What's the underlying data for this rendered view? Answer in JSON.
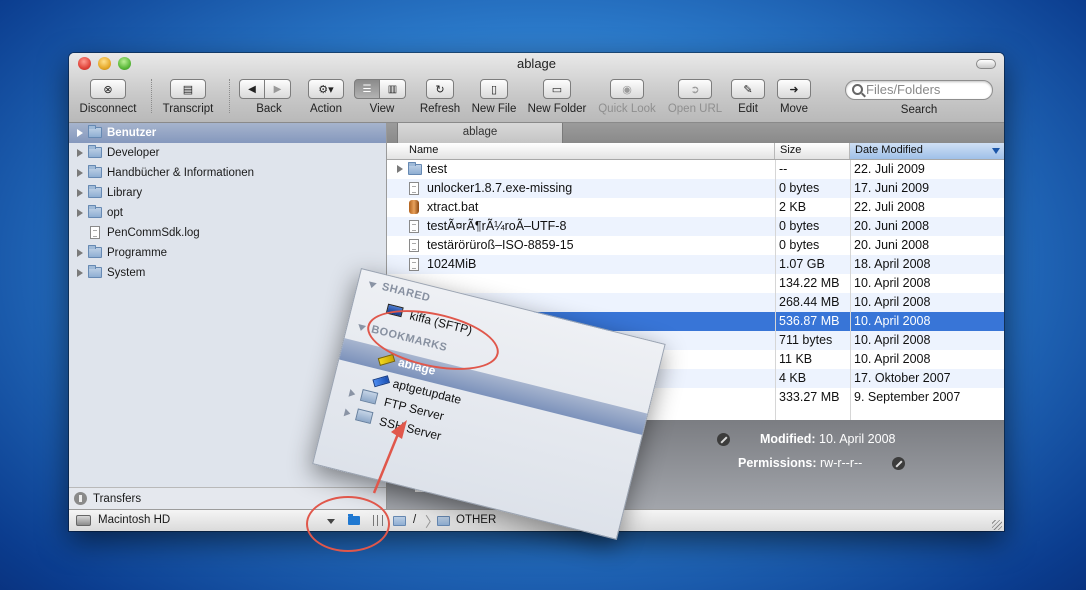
{
  "window": {
    "title": "ablage"
  },
  "toolbar": {
    "disconnect": "Disconnect",
    "transcript": "Transcript",
    "back": "Back",
    "action": "Action",
    "view": "View",
    "refresh": "Refresh",
    "new_file": "New File",
    "new_folder": "New Folder",
    "quick_look": "Quick Look",
    "open_url": "Open URL",
    "edit": "Edit",
    "move": "Move",
    "search_placeholder": "Files/Folders",
    "search_label": "Search"
  },
  "sidebar": {
    "items": [
      {
        "label": "Benutzer",
        "type": "folder",
        "selected": true
      },
      {
        "label": "Developer",
        "type": "folder"
      },
      {
        "label": "Handbücher & Informationen",
        "type": "folder"
      },
      {
        "label": "Library",
        "type": "folder"
      },
      {
        "label": "opt",
        "type": "folder"
      },
      {
        "label": "PenCommSdk.log",
        "type": "file"
      },
      {
        "label": "Programme",
        "type": "folder"
      },
      {
        "label": "System",
        "type": "folder"
      }
    ],
    "transfers": "Transfers",
    "disk": "Macintosh HD"
  },
  "tab": {
    "label": "ablage"
  },
  "columns": {
    "name": "Name",
    "size": "Size",
    "date": "Date Modified"
  },
  "files": [
    {
      "name": "test",
      "size": "--",
      "date": "22. Juli 2009",
      "kind": "folder"
    },
    {
      "name": "unlocker1.8.7.exe-missing",
      "size": "0 bytes",
      "date": "17. Juni 2009",
      "kind": "file"
    },
    {
      "name": "xtract.bat",
      "size": "2 KB",
      "date": "22. Juli 2008",
      "kind": "bat"
    },
    {
      "name": "testÃ¤rÃ¶rÃ¼roÃ–UTF-8",
      "size": "0 bytes",
      "date": "20. Juni 2008",
      "kind": "file"
    },
    {
      "name": "testärörüroß–ISO-8859-15",
      "size": "0 bytes",
      "date": "20. Juni 2008",
      "kind": "file"
    },
    {
      "name": "1024MiB",
      "size": "1.07 GB",
      "date": "18. April 2008",
      "kind": "file"
    },
    {
      "name": "",
      "size": "134.22 MB",
      "date": "10. April 2008",
      "kind": "none"
    },
    {
      "name": "",
      "size": "268.44 MB",
      "date": "10. April 2008",
      "kind": "none"
    },
    {
      "name": "",
      "size": "536.87 MB",
      "date": "10. April 2008",
      "kind": "none",
      "selected": true
    },
    {
      "name": "",
      "size": "711 bytes",
      "date": "10. April 2008",
      "kind": "none"
    },
    {
      "name": "",
      "size": "11 KB",
      "date": "10. April 2008",
      "kind": "none"
    },
    {
      "name": "",
      "size": "4 KB",
      "date": "17. Oktober 2007",
      "kind": "none"
    },
    {
      "name": "",
      "size": "333.27 MB",
      "date": "9. September 2007",
      "kind": "none"
    }
  ],
  "info": {
    "modified_label": "Modified:",
    "modified_value": "10. April 2008",
    "permissions_label": "Permissions:",
    "permissions_value": "rw-r--r--"
  },
  "path": {
    "root": "/",
    "folder": "OTHER"
  },
  "popup": {
    "shared_header": "SHARED",
    "shared_item": "kiffa (SFTP)",
    "bookmarks_header": "BOOKMARKS",
    "bookmarks": [
      "ablage",
      "aptgetupdate",
      "FTP Server",
      "SSH Server"
    ]
  },
  "colors": {
    "selection": "#3875d7",
    "annotation": "#e0574b"
  }
}
